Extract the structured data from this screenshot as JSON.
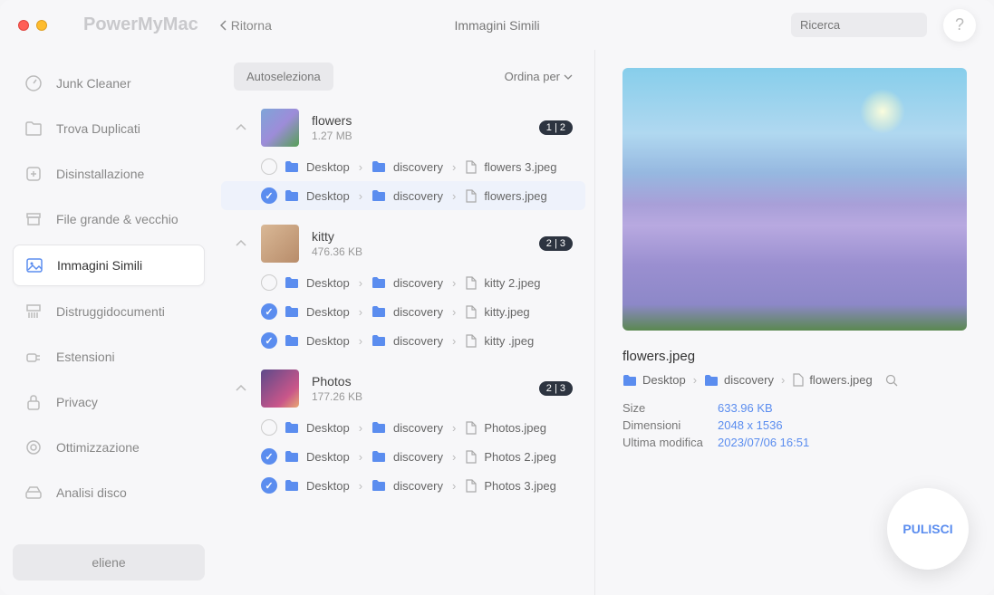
{
  "header": {
    "logo": "PowerMyMac",
    "back": "Ritorna",
    "page_title": "Immagini Simili",
    "search_placeholder": "Ricerca",
    "help": "?"
  },
  "sidebar": {
    "items": [
      {
        "label": "Junk Cleaner",
        "icon": "gauge"
      },
      {
        "label": "Trova Duplicati",
        "icon": "folder"
      },
      {
        "label": "Disinstallazione",
        "icon": "app"
      },
      {
        "label": "File grande & vecchio",
        "icon": "archive"
      },
      {
        "label": "Immagini Simili",
        "icon": "image",
        "active": true
      },
      {
        "label": "Distruggidocumenti",
        "icon": "shredder"
      },
      {
        "label": "Estensioni",
        "icon": "plugin"
      },
      {
        "label": "Privacy",
        "icon": "lock"
      },
      {
        "label": "Ottimizzazione",
        "icon": "optimize"
      },
      {
        "label": "Analisi disco",
        "icon": "disk"
      }
    ],
    "user": "eliene"
  },
  "toolbar": {
    "autoselect": "Autoseleziona",
    "sort": "Ordina per"
  },
  "path_parts": {
    "desktop": "Desktop",
    "discovery": "discovery"
  },
  "groups": [
    {
      "name": "flowers",
      "size": "1.27 MB",
      "badge": "1 | 2",
      "thumb": "flowers",
      "expanded": true,
      "files": [
        {
          "checked": false,
          "name": "flowers 3.jpeg",
          "selected": false
        },
        {
          "checked": true,
          "name": "flowers.jpeg",
          "selected": true
        }
      ]
    },
    {
      "name": "kitty",
      "size": "476.36 KB",
      "badge": "2 | 3",
      "thumb": "kitty",
      "expanded": true,
      "files": [
        {
          "checked": false,
          "name": "kitty 2.jpeg"
        },
        {
          "checked": true,
          "name": "kitty.jpeg"
        },
        {
          "checked": true,
          "name": "kitty .jpeg"
        }
      ]
    },
    {
      "name": "Photos",
      "size": "177.26 KB",
      "badge": "2 | 3",
      "thumb": "photos",
      "expanded": true,
      "files": [
        {
          "checked": false,
          "name": "Photos.jpeg"
        },
        {
          "checked": true,
          "name": "Photos 2.jpeg"
        },
        {
          "checked": true,
          "name": "Photos 3.jpeg"
        }
      ]
    }
  ],
  "detail": {
    "filename": "flowers.jpeg",
    "path": [
      "Desktop",
      "discovery",
      "flowers.jpeg"
    ],
    "meta": [
      {
        "label": "Size",
        "value": "633.96 KB"
      },
      {
        "label": "Dimensioni",
        "value": "2048 x 1536"
      },
      {
        "label": "Ultima modifica",
        "value": "2023/07/06 16:51"
      }
    ]
  },
  "clean_button": "PULISCI"
}
